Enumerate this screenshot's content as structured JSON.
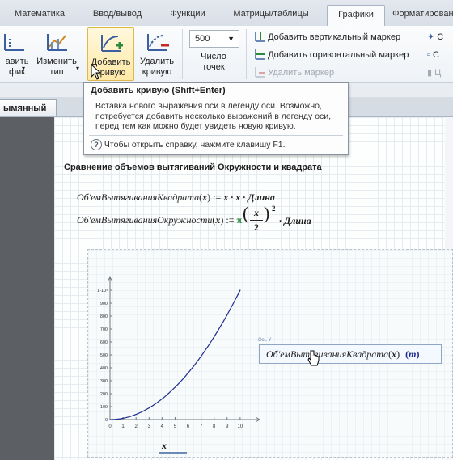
{
  "tabs": [
    "Математика",
    "Ввод/вывод",
    "Функции",
    "Матрицы/таблицы",
    "Графики",
    "Форматирование"
  ],
  "ribbon": {
    "add_graph_label1": "авить",
    "add_graph_label2": "фик",
    "change_type_label1": "Изменить",
    "change_type_label2": "тип",
    "add_curve_label1": "Добавить",
    "add_curve_label2": "кривую",
    "remove_curve_label1": "Удалить",
    "remove_curve_label2": "кривую",
    "points_value": "500",
    "points_label1": "Число",
    "points_label2": "точек",
    "add_vertical_marker": "Добавить вертикальный маркер",
    "add_horizontal_marker": "Добавить горизонтальный маркер",
    "remove_marker": "Удалить маркер",
    "right_item1": "С",
    "right_item2": "С",
    "right_item3": "Ц"
  },
  "doc_tab": "ымянный",
  "tooltip": {
    "title": "Добавить кривую (Shift+Enter)",
    "body_line1": "Вставка нового выражения оси в легенду оси. Возможно,",
    "body_line2": "потребуется добавить несколько выражений в легенду оси,",
    "body_line3": "перед тем как можно будет увидеть новую кривую.",
    "help": "Чтобы открыть справку, нажмите клавишу F1."
  },
  "sheet": {
    "heading": "Сравнение объемов вытягиваний Окружности и квадрата",
    "eq1_name": "Об'емВытягиванияКвадрата",
    "eq1_arg": "x",
    "eq1_rhs": "x · x · Длина",
    "eq2_name": "Об'емВытягиванияОкружности",
    "eq2_arg": "x",
    "eq2_pi": "π",
    "eq2_frac_num": "x",
    "eq2_frac_den": "2",
    "eq2_exp": "2",
    "eq2_tail": "· Длина",
    "def_sign": ":=",
    "legend_small": "Ось Y",
    "legend_expr": "Об'емВытягиванияКвадрата",
    "legend_arg": "x",
    "legend_unit": "m",
    "x_axis_label": "x"
  },
  "colors": {
    "curve": "#1f2c8f",
    "accent": "#2b8a3e",
    "tooltip_border": "#8a949e",
    "selected_button": "#ffe9a8"
  },
  "chart_data": {
    "type": "line",
    "series": [
      {
        "x": [
          0,
          1,
          2,
          3,
          4,
          5,
          6,
          7,
          8,
          9,
          10
        ],
        "y": [
          0,
          10,
          40,
          90,
          160,
          250,
          360,
          490,
          640,
          810,
          1000
        ]
      }
    ],
    "xticks": [
      "0",
      "1",
      "2",
      "3",
      "4",
      "5",
      "6",
      "7",
      "8",
      "9",
      "10"
    ],
    "yticks": [
      "0",
      "100",
      "200",
      "300",
      "400",
      "500",
      "600",
      "700",
      "800",
      "900",
      "1·10³"
    ],
    "xlim": [
      0,
      11.5
    ],
    "ylim": [
      0,
      1100
    ],
    "xlabel": "x"
  }
}
